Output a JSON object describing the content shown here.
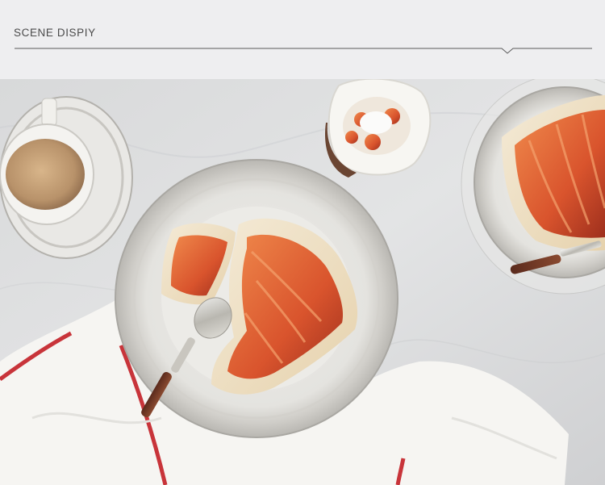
{
  "header": {
    "title": "SCENE DISPIY"
  },
  "photo": {
    "background_color": "#dfe0e1",
    "accent_color": "#e8733a",
    "towel_stripe_color": "#c8343a",
    "items": [
      "coffee-cup-icon",
      "galette-plate-icon",
      "apricot-bowl-icon",
      "dessert-plate-icon",
      "spoon-icon",
      "fork-icon",
      "kitchen-towel-icon"
    ]
  }
}
